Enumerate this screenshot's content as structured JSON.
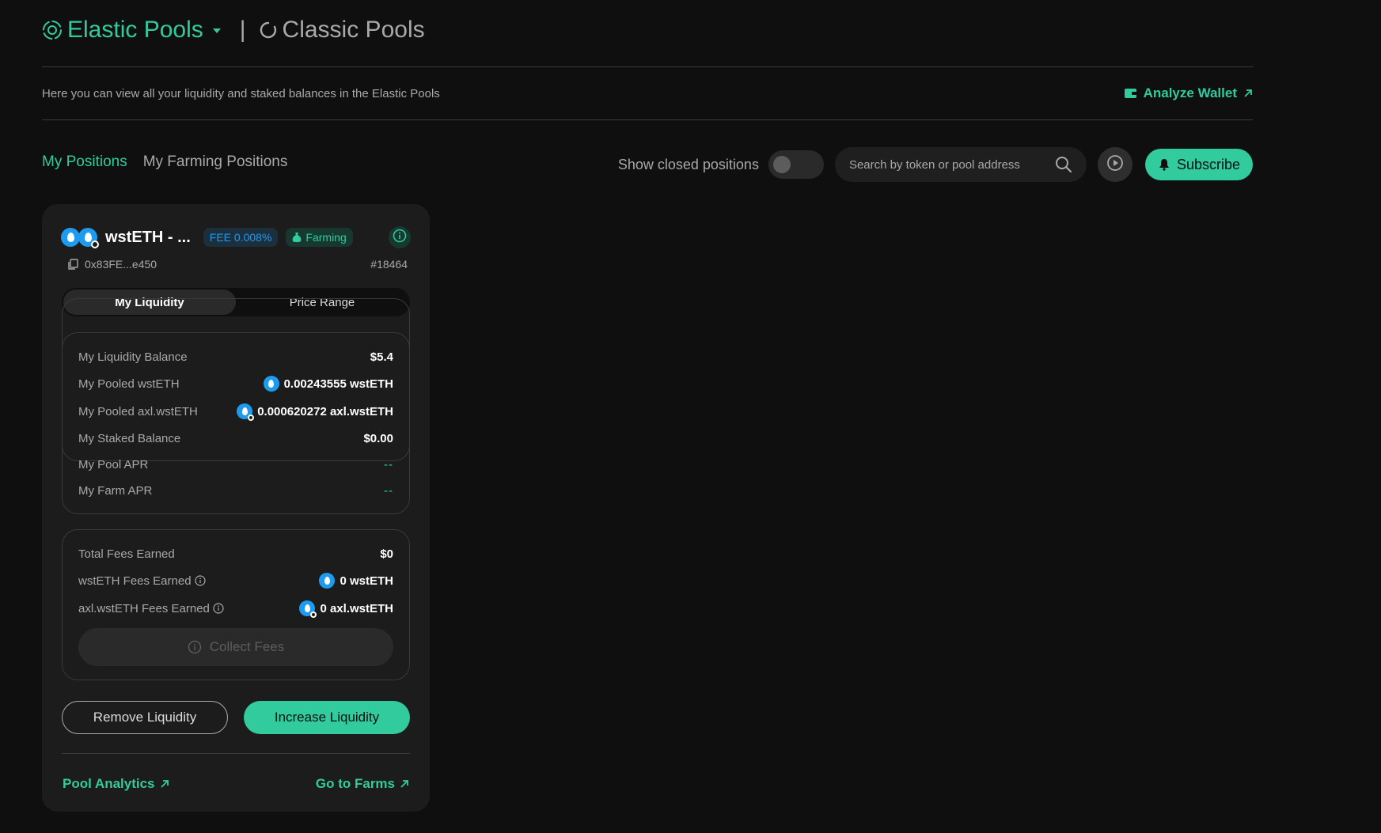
{
  "header": {
    "elastic_label": "Elastic Pools",
    "separator": "|",
    "classic_label": "Classic Pools"
  },
  "intro": {
    "description": "Here you can view all your liquidity and staked balances in the Elastic Pools",
    "analyze_label": "Analyze Wallet"
  },
  "tabs": [
    {
      "label": "My Positions",
      "active": true
    },
    {
      "label": "My Farming Positions",
      "active": false
    }
  ],
  "controls": {
    "show_closed_label": "Show closed positions",
    "show_closed_on": false,
    "search_placeholder": "Search by token or pool address",
    "subscribe_label": "Subscribe"
  },
  "position": {
    "pair_name": "wstETH - ...",
    "fee_label": "FEE 0.008%",
    "farming_label": "Farming",
    "address": "0x83FE...e450",
    "position_id": "#18464",
    "segments": [
      "My Liquidity",
      "Price Range"
    ],
    "liquidity": {
      "balance_label": "My Liquidity Balance",
      "balance_value": "$5.4",
      "pooled_a_label": "My Pooled wstETH",
      "pooled_a_value": "0.00243555 wstETH",
      "pooled_b_label": "My Pooled axl.wstETH",
      "pooled_b_value": "0.000620272 axl.wstETH",
      "staked_label": "My Staked Balance",
      "staked_value": "$0.00",
      "pool_apr_label": "My Pool APR",
      "pool_apr_value": "--",
      "farm_apr_label": "My Farm APR",
      "farm_apr_value": "--"
    },
    "fees": {
      "total_label": "Total Fees Earned",
      "total_value": "$0",
      "fee_a_label": "wstETH Fees Earned",
      "fee_a_value": "0 wstETH",
      "fee_b_label": "axl.wstETH Fees Earned",
      "fee_b_value": "0 axl.wstETH",
      "collect_label": "Collect Fees"
    },
    "remove_label": "Remove Liquidity",
    "increase_label": "Increase Liquidity",
    "pool_analytics_label": "Pool Analytics",
    "go_to_farms_label": "Go to Farms"
  },
  "colors": {
    "accent": "#31cb9e",
    "background": "#0f0f0f",
    "card": "#1c1c1c",
    "token_blue": "#1d9bf0",
    "muted_text": "#a9a9a9"
  },
  "icons": [
    "elastic-icon",
    "classic-icon",
    "wallet-icon",
    "external-arrow-icon",
    "search-icon",
    "play-icon",
    "bell-icon",
    "money-bag-icon",
    "info-icon",
    "copy-icon"
  ]
}
